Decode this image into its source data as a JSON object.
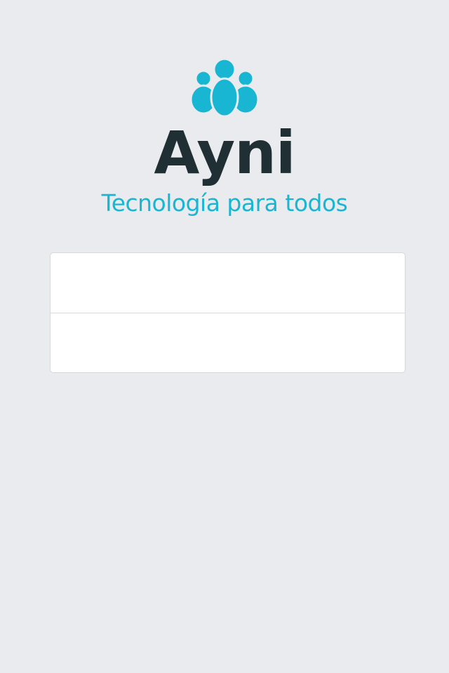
{
  "brand": {
    "name": "Ayni",
    "tagline": "Tecnología para todos",
    "logo_icon": "people-group-icon",
    "accent_color": "#18b6d2",
    "name_color": "#1f2f33"
  },
  "login_form": {
    "username": {
      "value": "",
      "placeholder": ""
    },
    "password": {
      "value": "",
      "placeholder": ""
    }
  },
  "colors": {
    "background": "#e9ebee",
    "panel": "#ffffff",
    "panel_border": "#d6d8dc"
  }
}
